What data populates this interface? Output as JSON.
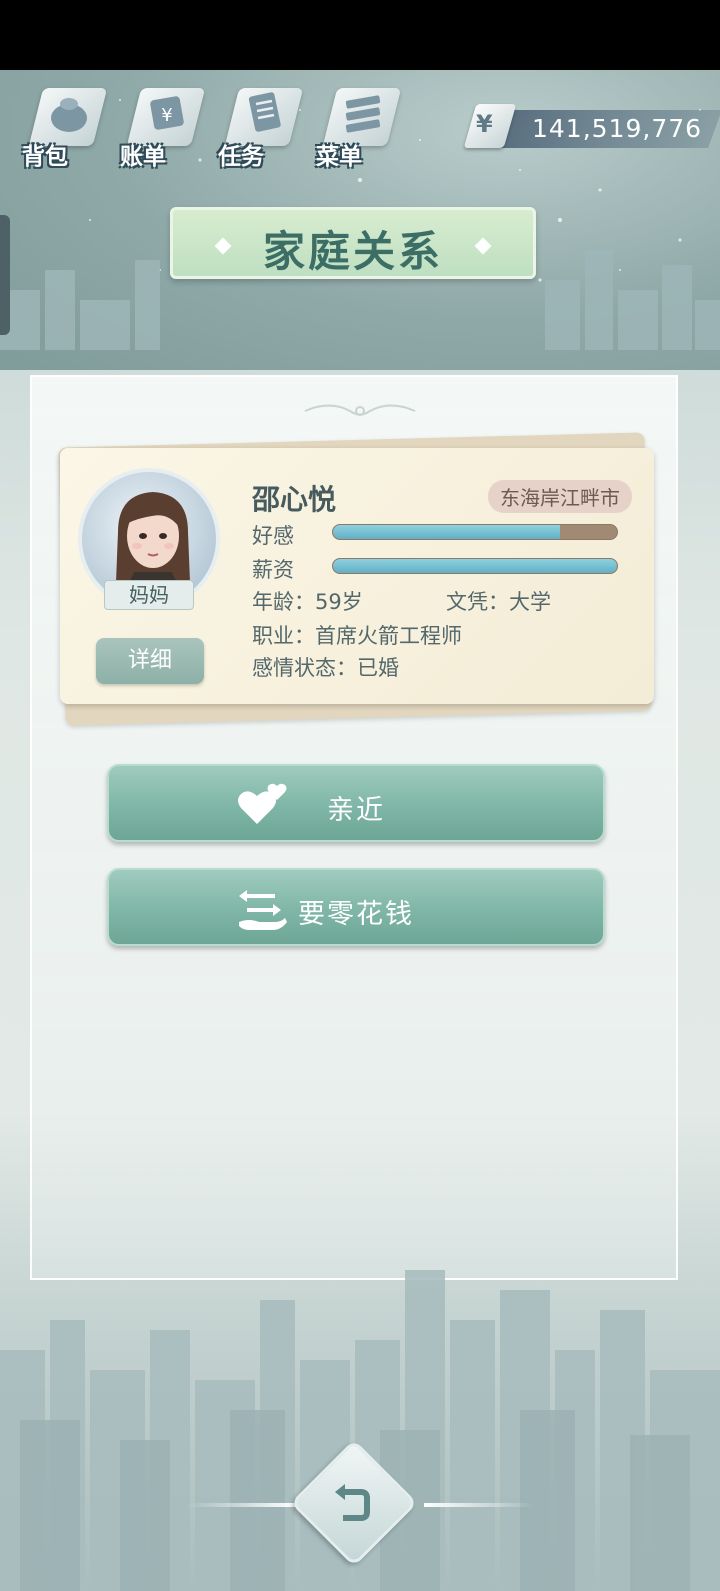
{
  "topnav": {
    "items": [
      {
        "label": "背包",
        "icon": "bag-icon"
      },
      {
        "label": "账单",
        "icon": "bill-icon"
      },
      {
        "label": "任务",
        "icon": "task-icon"
      },
      {
        "label": "菜单",
        "icon": "menu-icon"
      }
    ],
    "currency_symbol": "¥",
    "money": "141,519,776"
  },
  "page": {
    "title": "家庭关系"
  },
  "member": {
    "name": "邵心悦",
    "relation": "妈妈",
    "location": "东海岸江畔市",
    "favor_label": "好感",
    "favor_level": 0.8,
    "salary_label": "薪资",
    "salary_level": 1.0,
    "age": "年龄：59岁",
    "education": "文凭：大学",
    "job": "职业：首席火箭工程师",
    "relationship": "感情状态：已婚",
    "detail_button": "详细"
  },
  "actions": {
    "approach": {
      "label": "亲近",
      "icon": "hearts-icon"
    },
    "pocket_money": {
      "label": "要零花钱",
      "icon": "money-exchange-icon"
    }
  },
  "colors": {
    "accent": "#7fb6a7",
    "title_text": "#3c6e66",
    "bar_fill": "#62afc5",
    "bar_empty": "#a08a73"
  },
  "back": {
    "icon": "back-arrow-icon"
  }
}
